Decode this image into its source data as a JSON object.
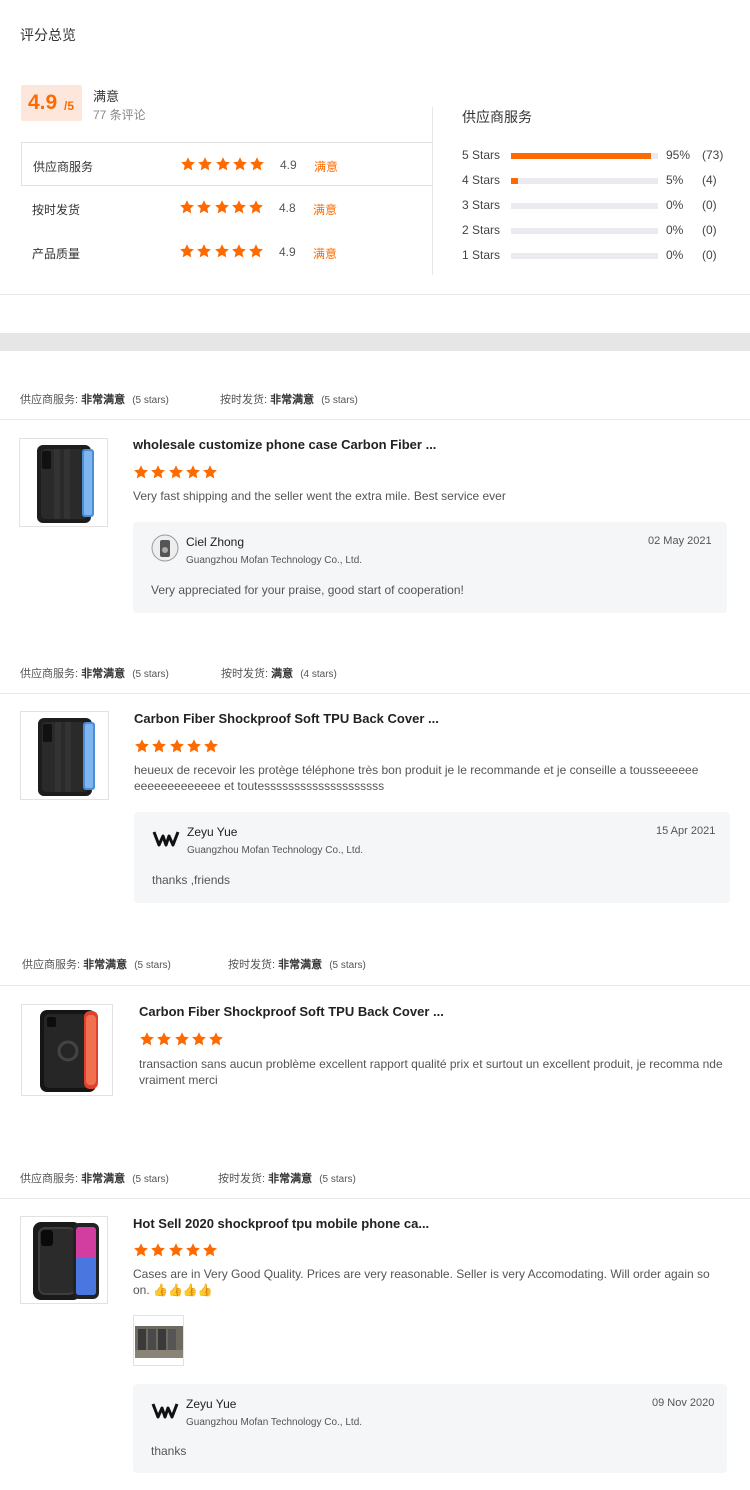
{
  "summary": {
    "title": "评分总览",
    "score": "4.9",
    "score_max": "/5",
    "overall_label": "满意",
    "review_count": "77 条评论",
    "rows": [
      {
        "label": "供应商服务",
        "stars": 5,
        "score": "4.9",
        "status": "满意"
      },
      {
        "label": "按时发货",
        "stars": 5,
        "score": "4.8",
        "status": "满意"
      },
      {
        "label": "产品质量",
        "stars": 5,
        "score": "4.9",
        "status": "满意"
      }
    ]
  },
  "distribution": {
    "title": "供应商服务",
    "rows": [
      {
        "label": "5 Stars",
        "fraction": 0.95,
        "pct": "95%",
        "count": "(73)"
      },
      {
        "label": "4 Stars",
        "fraction": 0.05,
        "pct": "5%",
        "count": "(4)"
      },
      {
        "label": "3 Stars",
        "fraction": 0,
        "pct": "0%",
        "count": "(0)"
      },
      {
        "label": "2 Stars",
        "fraction": 0,
        "pct": "0%",
        "count": "(0)"
      },
      {
        "label": "1 Stars",
        "fraction": 0,
        "pct": "0%",
        "count": "(0)"
      }
    ]
  },
  "reviews": [
    {
      "meta1_key": "供应商服务:",
      "meta1_val": "非常满意",
      "meta1_stars": "(5 stars)",
      "meta2_key": "按时发货:",
      "meta2_val": "非常满意",
      "meta2_stars": "(5 stars)",
      "product_title": "wholesale customize phone case Carbon Fiber ...",
      "rating": 5,
      "text": "Very fast shipping and the seller went the extra mile. Best service ever",
      "reply": {
        "name": "Ciel Zhong",
        "company": "Guangzhou Mofan Technology Co., Ltd.",
        "date": "02 May 2021",
        "message": "Very appreciated for your praise, good start of cooperation!"
      }
    },
    {
      "meta1_key": "供应商服务:",
      "meta1_val": "非常满意",
      "meta1_stars": "(5 stars)",
      "meta2_key": "按时发货:",
      "meta2_val": "满意",
      "meta2_stars": "(4 stars)",
      "product_title": "Carbon Fiber Shockproof Soft TPU Back Cover ...",
      "rating": 5,
      "text": "heueux  de  recevoir les protège téléphone très bon produit je le recommande et je conseille a tousseeeeee eeeeeeeeeeeee et toutessssssssssssssssssss",
      "reply": {
        "name": "Zeyu Yue",
        "company": "Guangzhou Mofan Technology Co., Ltd.",
        "date": "15 Apr 2021",
        "message": "thanks ,friends"
      }
    },
    {
      "meta1_key": "供应商服务:",
      "meta1_val": "非常满意",
      "meta1_stars": "(5 stars)",
      "meta2_key": "按时发货:",
      "meta2_val": "非常满意",
      "meta2_stars": "(5 stars)",
      "product_title": "Carbon Fiber Shockproof Soft TPU Back Cover ...",
      "rating": 5,
      "text": "transaction sans aucun problème excellent rapport qualité prix et surtout un excellent produit, je recomma nde vraiment merci"
    },
    {
      "meta1_key": "供应商服务:",
      "meta1_val": "非常满意",
      "meta1_stars": "(5 stars)",
      "meta2_key": "按时发货:",
      "meta2_val": "非常满意",
      "meta2_stars": "(5 stars)",
      "product_title": "Hot Sell 2020 shockproof tpu mobile phone ca...",
      "rating": 5,
      "text": "Cases are in Very Good Quality. Prices are very reasonable. Seller is very Accomodating. Will order again so on. 👍👍👍👍",
      "reply": {
        "name": "Zeyu Yue",
        "company": "Guangzhou Mofan Technology Co., Ltd.",
        "date": "09 Nov 2020",
        "message": "thanks"
      }
    }
  ],
  "colors": {
    "accent": "#ff6a00",
    "accent_bg": "#fde7dc",
    "reply_bg": "#f5f6f8"
  }
}
